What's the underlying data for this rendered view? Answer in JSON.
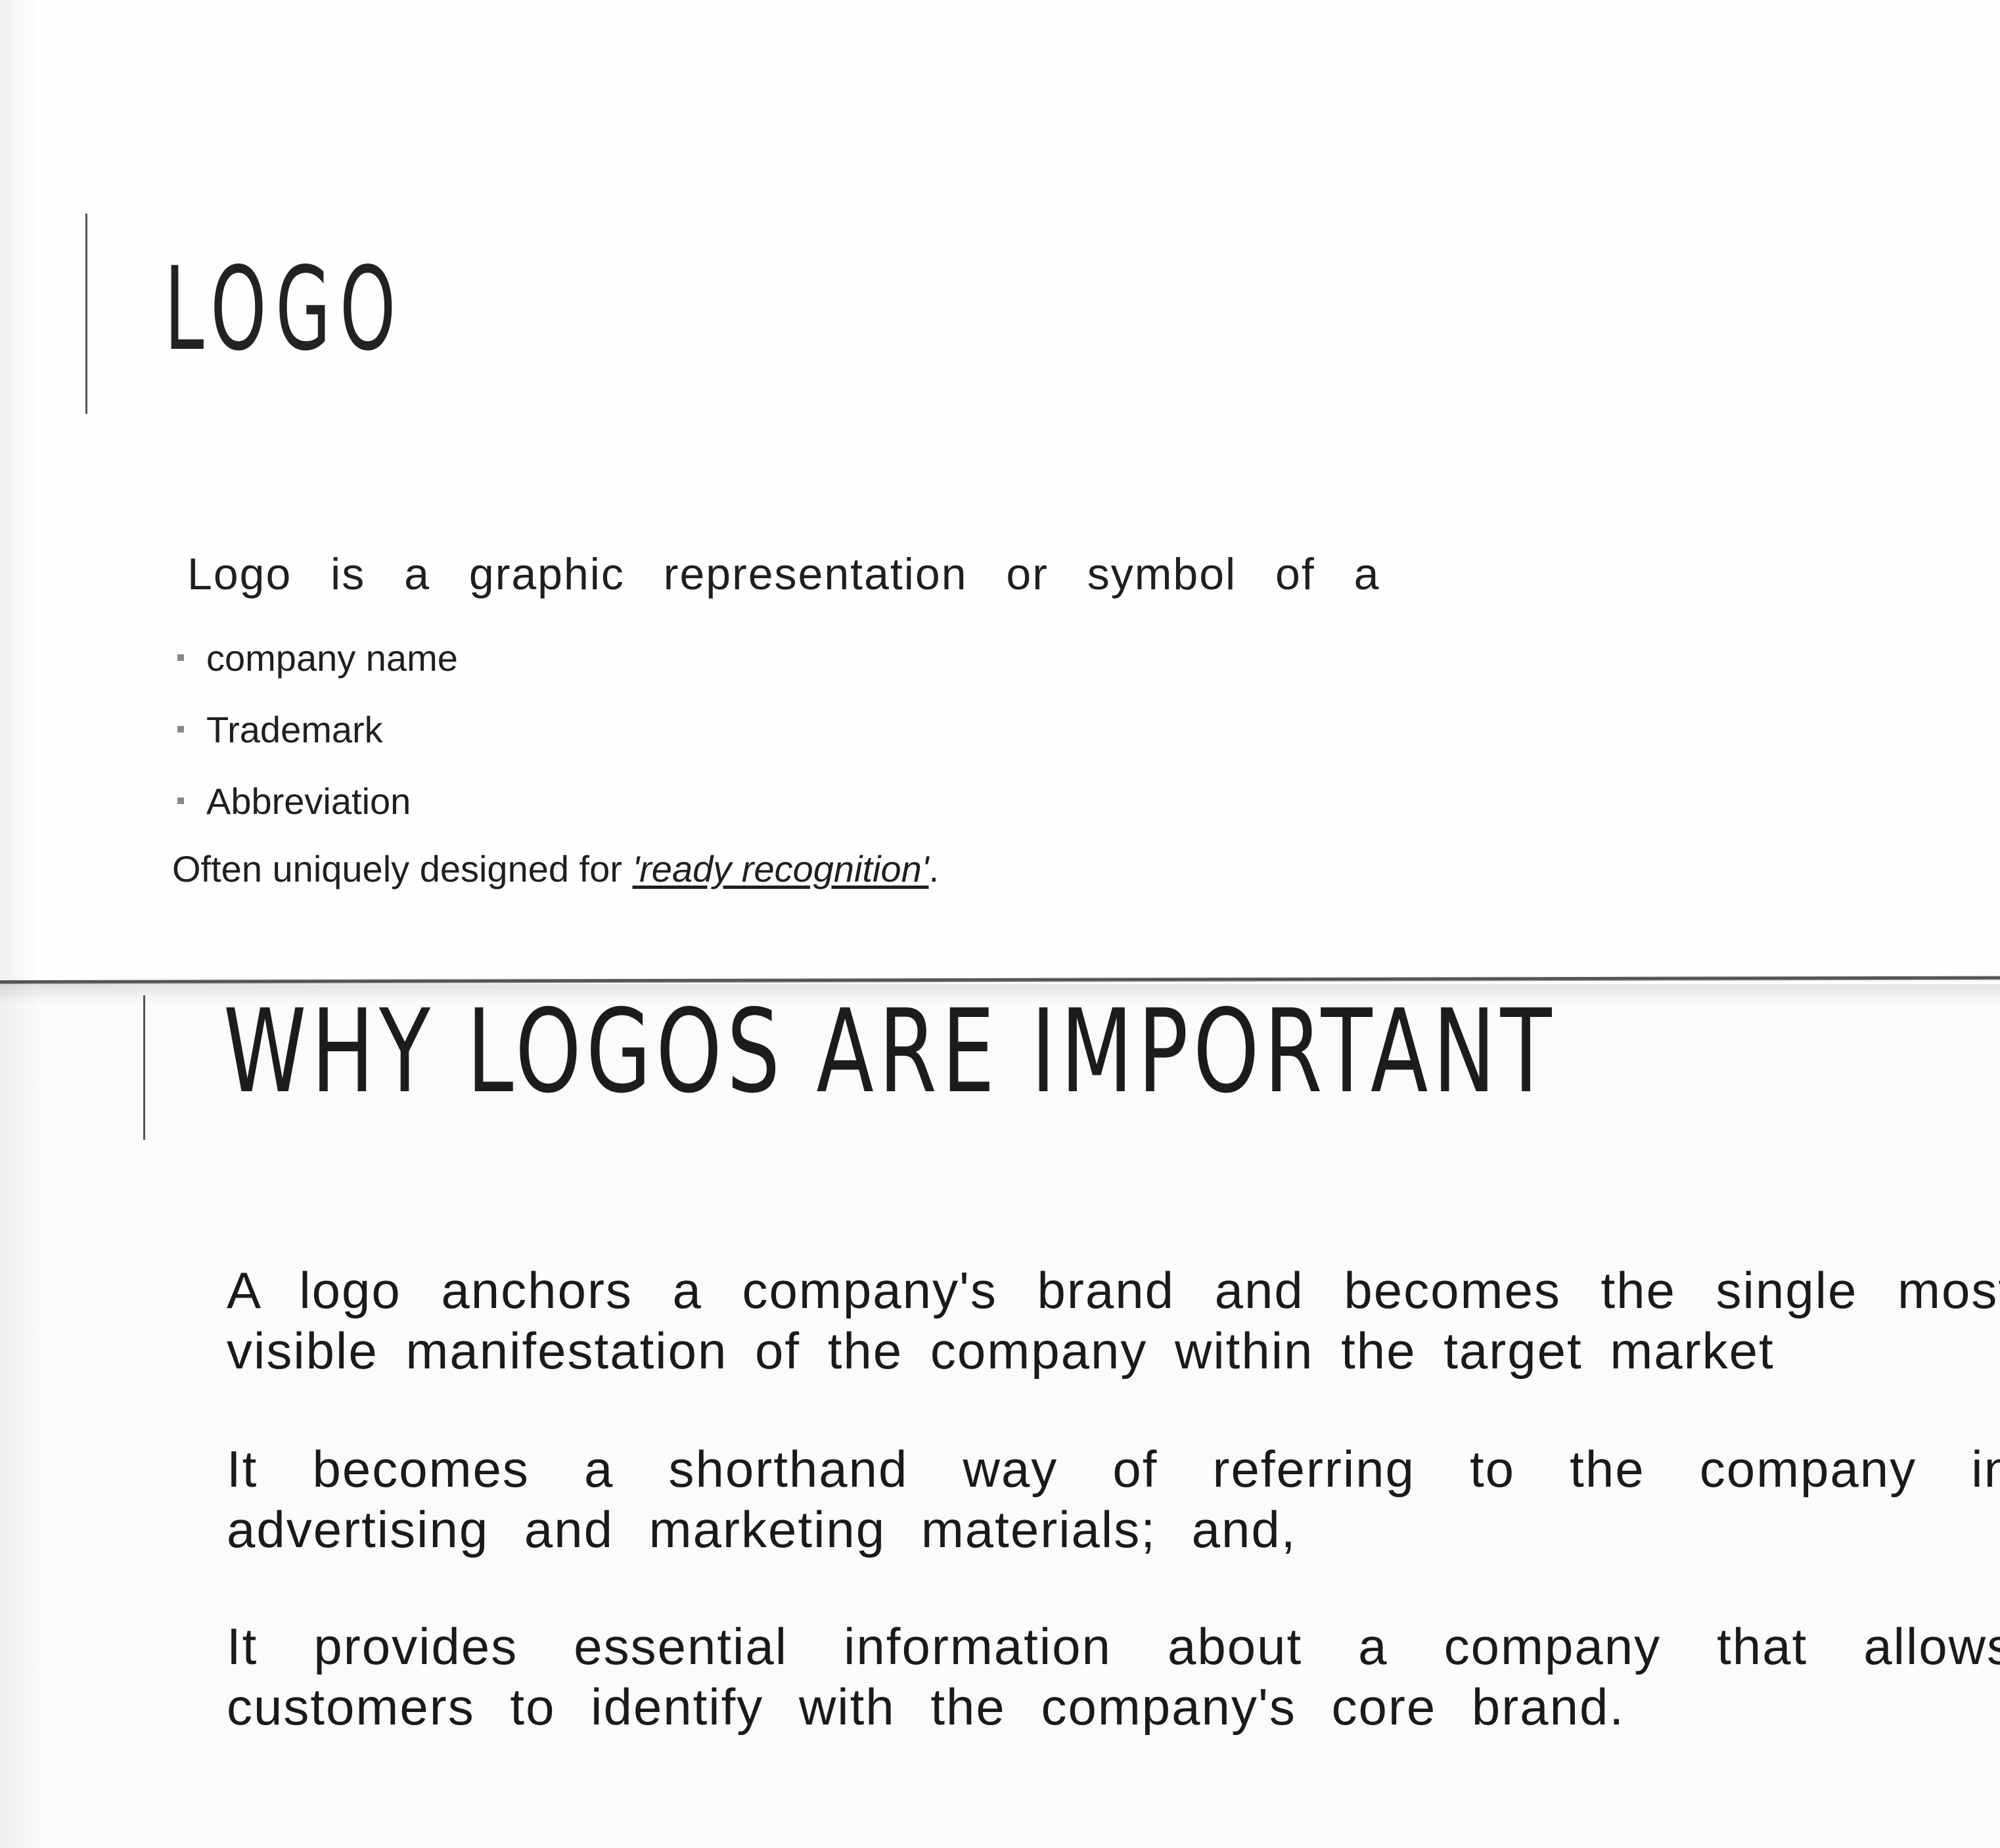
{
  "slide1": {
    "title": "LOGO",
    "intro": "Logo is a graphic representation or symbol of a",
    "bullets": [
      "company name",
      "Trademark",
      "Abbreviation"
    ],
    "often_prefix": "Often uniquely designed for ",
    "often_quote": "'ready recognition'",
    "often_suffix": "."
  },
  "slide2": {
    "title": "WHY LOGOS ARE IMPORTANT",
    "paragraphs": [
      "A logo anchors a company's brand and becomes the single most visible manifestation of the company within the target market",
      "It becomes a shorthand way of referring to the company in advertising and marketing materials; and,",
      "It provides essential information about a company that allows customers to identify with the company's core brand."
    ]
  }
}
